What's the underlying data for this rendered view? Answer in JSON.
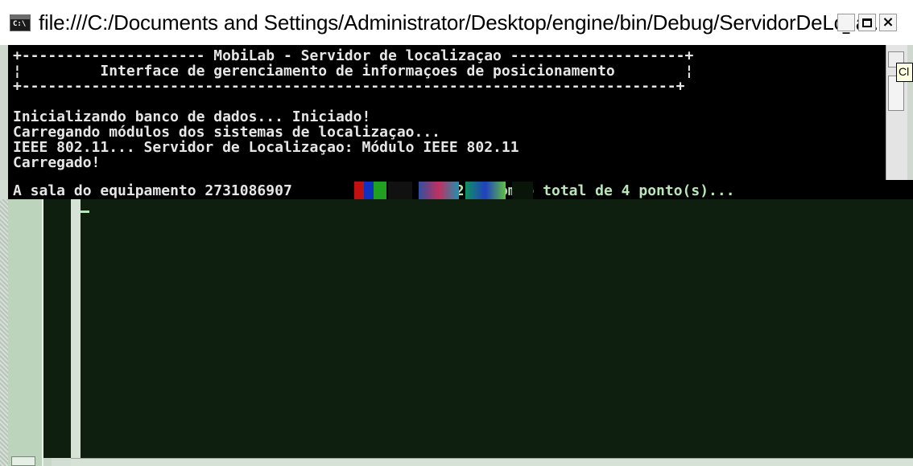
{
  "window": {
    "title": "file:///C:/Documents and Settings/Administrator/Desktop/engine/bin/Debug/ServidorDeLoca...",
    "icon": "cmd-icon",
    "icon_text": "C:\\",
    "minimize_label": "_",
    "close_label": "×"
  },
  "console": {
    "lines": [
      "+--------------------- MobiLab - Servidor de localizaçao --------------------+",
      "¦         Interface de gerenciamento de informaçoes de posicionamento        ¦",
      "+---------------------------------------------------------------------------+",
      "",
      "Inicializando banco de dados... Iniciado!",
      "Carregando módulos dos sistemas de localizaçao...",
      "IEEE 802.11... Servidor de Localizaçao: Módulo IEEE 802.11",
      "Carregado!"
    ],
    "sala_prefix": "A sala do equipamento 2731086907",
    "sala_suffix": "210 com o total de 4 ponto(s)...",
    "cursor": "_"
  },
  "tooltip": {
    "text": "Cl"
  },
  "colors": {
    "console_bg": "#000000",
    "console_fg": "#e6e6e6",
    "green_fg": "#b8e6b8",
    "dark_panel": "#0f1f0f"
  }
}
